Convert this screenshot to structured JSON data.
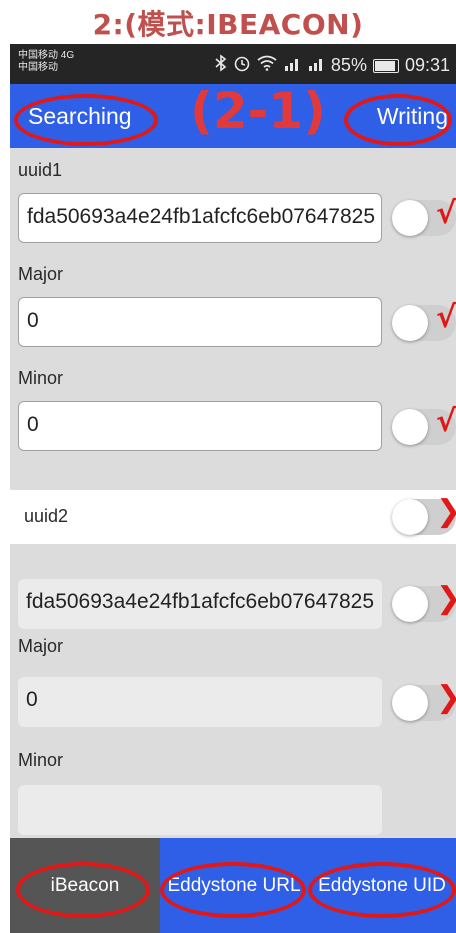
{
  "caption": "2:(模式:IBEACON)",
  "status_bar": {
    "carrier_line1": "中国移动 4G",
    "carrier_line2": "中国移动",
    "icons": [
      "bluetooth-icon",
      "alarm-icon",
      "wifi-icon",
      "signal-4g-icon",
      "signal-icon"
    ],
    "battery": "85%",
    "battery_level": 0.85,
    "time": "09:31"
  },
  "topbar": {
    "searching_label": "Searching",
    "step_label": "(2-1)",
    "writing_label": "Writing",
    "color": "#2f5fe6"
  },
  "form": {
    "uuid1_label": "uuid1",
    "uuid1_value": "fda50693a4e24fb1afcfc6eb07647825",
    "major1_label": "Major",
    "major1_value": "0",
    "minor1_label": "Minor",
    "minor1_value": "0",
    "uuid2_label": "uuid2",
    "uuid2_value": "fda50693a4e24fb1afcfc6eb07647825",
    "major2_label": "Major",
    "major2_value": "0",
    "minor2_label": "Minor",
    "check_mark": "√",
    "cross_mark": "❯"
  },
  "tabs": {
    "ibeacon": "iBeacon",
    "eddystone_url": "Eddystone URL",
    "eddystone_uid": "Eddystone UID",
    "active": "iBeacon"
  },
  "navbar": {
    "icons": [
      "chevron-down-icon",
      "back-icon",
      "home-icon",
      "recents-icon"
    ]
  },
  "annotation_color": "#e01818"
}
